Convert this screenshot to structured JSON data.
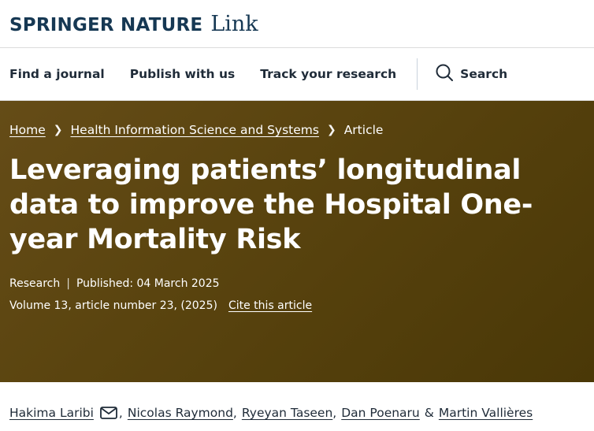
{
  "brand": {
    "name": "SPRINGER NATURE",
    "suffix": "Link"
  },
  "nav": {
    "items": [
      "Find a journal",
      "Publish with us",
      "Track your research"
    ],
    "search_label": "Search"
  },
  "breadcrumb": [
    "Home",
    "Health Information Science and Systems",
    "Article"
  ],
  "article": {
    "title": "Leveraging patients’ longitudinal data to improve the Hospital One-year Mortality Risk",
    "type": "Research",
    "published": "Published: 04 March 2025",
    "volume": "Volume 13, article number 23, (2025)",
    "cite_label": "Cite this article"
  },
  "authors": [
    "Hakima Laribi",
    "Nicolas Raymond",
    "Ryeyan Taseen",
    "Dan Poenaru",
    "Martin Vallières"
  ],
  "colors": {
    "hero_bg": "#5a440f",
    "brand_blue": "#163853"
  }
}
